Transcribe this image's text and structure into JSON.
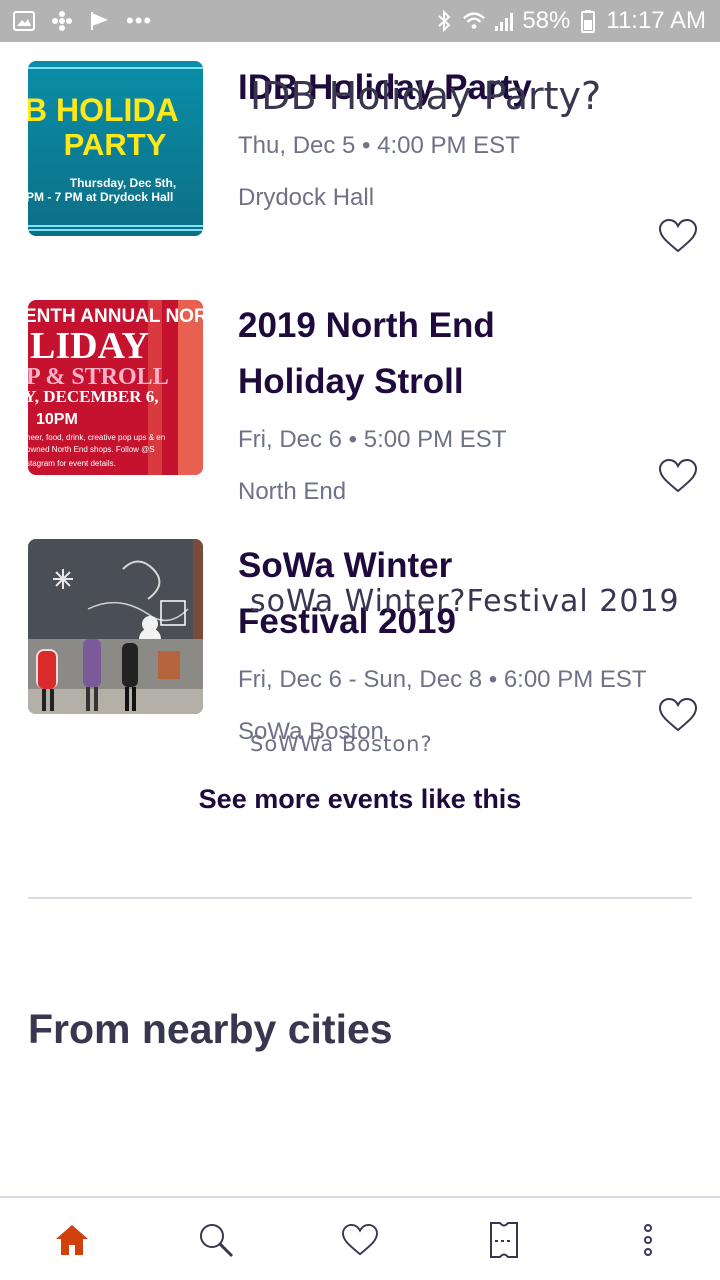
{
  "status_bar": {
    "battery": "58%",
    "time": "11:17 AM",
    "left_icons": [
      "gallery-icon",
      "fan-icon",
      "flag-icon",
      "more-dots-icon"
    ],
    "more_dots": "•••"
  },
  "events": [
    {
      "title": "IDB Holiday Party",
      "ghost_title": "IDB Holiday Party?",
      "date": "Thu, Dec 5 • 4:00 PM EST",
      "venue": "Drydock Hall",
      "thumb": {
        "line1": "B HOLIDA",
        "line2": "PARTY",
        "line3": "Thursday, Dec 5th,",
        "line4": "PM - 7 PM at Drydock Hall"
      }
    },
    {
      "title_line1": "2019 North End",
      "title_line2": "Holiday Stroll",
      "date": "Fri, Dec 6 • 5:00 PM EST",
      "venue": "North End",
      "thumb": {
        "line1": "ENTH ANNUAL NOR",
        "line2": "LIDAY",
        "line3": "P & STROLL",
        "line4": "Y, DECEMBER 6,",
        "line5": "10PM",
        "line6": "heer, food, drink, creative pop ups & en",
        "line7": "owned North End shops. Follow @S",
        "line8": "stagram for event details."
      }
    },
    {
      "title_line1": "SoWa Winter",
      "title_line2": "Festival 2019",
      "ghost_title": "soWa Winter?Festival 2019",
      "date": "Fri, Dec 6 - Sun, Dec 8 • 6:00 PM EST",
      "venue": "SoWa Boston",
      "ghost_venue": "SoWWa Boston?"
    }
  ],
  "see_more": "See more events like this",
  "section_title": "From nearby cities",
  "nav": [
    "home-icon",
    "search-icon",
    "heart-icon",
    "ticket-icon",
    "more-vertical-icon"
  ],
  "colors": {
    "accent": "#d1410c",
    "title": "#1e0a3c",
    "meta": "#6f7287",
    "status_bar": "#b3b3b3"
  }
}
